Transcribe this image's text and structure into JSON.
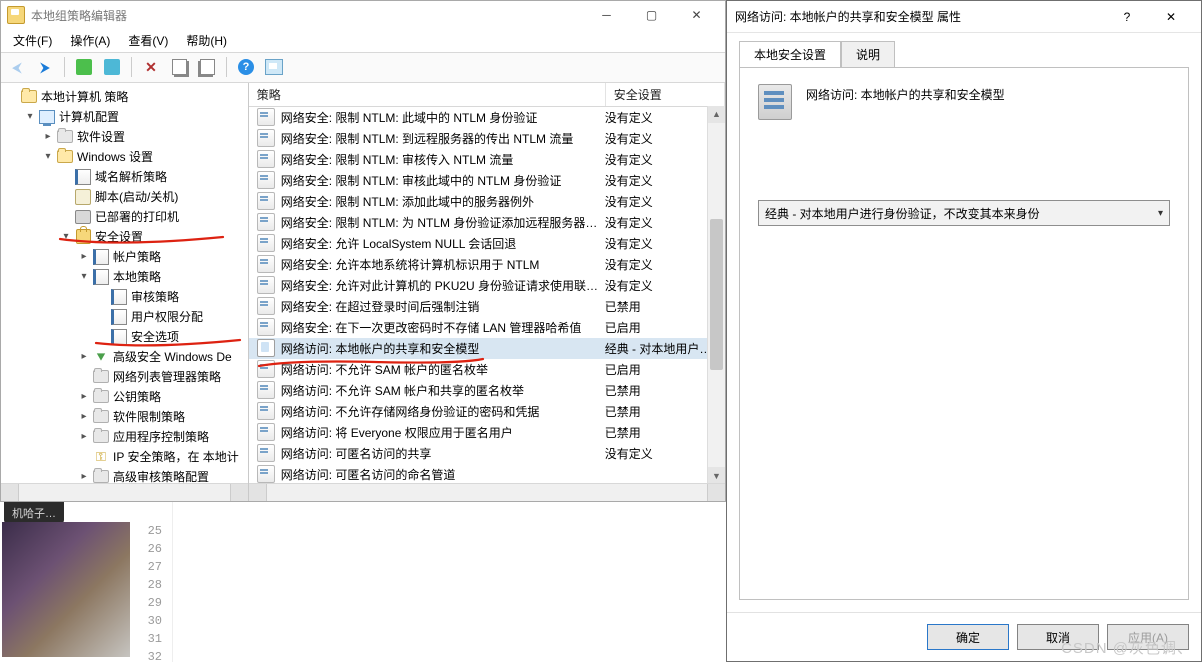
{
  "mmc": {
    "title": "本地组策略编辑器",
    "menu": {
      "file": "文件(F)",
      "action": "操作(A)",
      "view": "查看(V)",
      "help": "帮助(H)"
    },
    "columns": {
      "policy": "策略",
      "setting": "安全设置"
    }
  },
  "tree": {
    "root": "本地计算机 策略",
    "computerCfg": "计算机配置",
    "swSettings": "软件设置",
    "winSettings": "Windows 设置",
    "nameResPol": "域名解析策略",
    "scripts": "脚本(启动/关机)",
    "printers": "已部署的打印机",
    "secSettings": "安全设置",
    "acctPol": "帐户策略",
    "localPol": "本地策略",
    "auditPol": "审核策略",
    "userRights": "用户权限分配",
    "secOptions": "安全选项",
    "advFirewall": "高级安全 Windows De",
    "nlmPol": "网络列表管理器策略",
    "pubKeyPol": "公钥策略",
    "srPol": "软件限制策略",
    "appCtrl": "应用程序控制策略",
    "ipsec": "IP 安全策略，在 本地计",
    "advAudit": "高级审核策略配置"
  },
  "policies": [
    {
      "name": "网络安全: 限制 NTLM: 此域中的 NTLM 身份验证",
      "value": "没有定义",
      "icon": 1
    },
    {
      "name": "网络安全: 限制 NTLM: 到远程服务器的传出 NTLM 流量",
      "value": "没有定义",
      "icon": 1
    },
    {
      "name": "网络安全: 限制 NTLM: 审核传入 NTLM 流量",
      "value": "没有定义",
      "icon": 1
    },
    {
      "name": "网络安全: 限制 NTLM: 审核此域中的 NTLM 身份验证",
      "value": "没有定义",
      "icon": 1
    },
    {
      "name": "网络安全: 限制 NTLM: 添加此域中的服务器例外",
      "value": "没有定义",
      "icon": 1
    },
    {
      "name": "网络安全: 限制 NTLM: 为 NTLM 身份验证添加远程服务器…",
      "value": "没有定义",
      "icon": 1
    },
    {
      "name": "网络安全: 允许 LocalSystem NULL 会话回退",
      "value": "没有定义",
      "icon": 1
    },
    {
      "name": "网络安全: 允许本地系统将计算机标识用于 NTLM",
      "value": "没有定义",
      "icon": 1
    },
    {
      "name": "网络安全: 允许对此计算机的 PKU2U 身份验证请求使用联…",
      "value": "没有定义",
      "icon": 1
    },
    {
      "name": "网络安全: 在超过登录时间后强制注销",
      "value": "已禁用",
      "icon": 1
    },
    {
      "name": "网络安全: 在下一次更改密码时不存储 LAN 管理器哈希值",
      "value": "已启用",
      "icon": 1
    },
    {
      "name": "网络访问: 本地帐户的共享和安全模型",
      "value": "经典 - 对本地用户进行",
      "icon": 2,
      "sel": true
    },
    {
      "name": "网络访问: 不允许 SAM 帐户的匿名枚举",
      "value": "已启用",
      "icon": 1
    },
    {
      "name": "网络访问: 不允许 SAM 帐户和共享的匿名枚举",
      "value": "已禁用",
      "icon": 1
    },
    {
      "name": "网络访问: 不允许存储网络身份验证的密码和凭据",
      "value": "已禁用",
      "icon": 1
    },
    {
      "name": "网络访问: 将 Everyone 权限应用于匿名用户",
      "value": "已禁用",
      "icon": 1
    },
    {
      "name": "网络访问: 可匿名访问的共享",
      "value": "没有定义",
      "icon": 1
    },
    {
      "name": "网络访问: 可匿名访问的命名管道",
      "value": "",
      "icon": 1
    }
  ],
  "dialog": {
    "title": "网络访问: 本地帐户的共享和安全模型 属性",
    "tab_setting": "本地安全设置",
    "tab_explain": "说明",
    "policy_name": "网络访问: 本地帐户的共享和安全模型",
    "combo_value": "经典 - 对本地用户进行身份验证，不改变其本来身份",
    "help": "?",
    "ok": "确定",
    "cancel": "取消",
    "apply": "应用(A)"
  },
  "editor": {
    "tab": "机哈子…",
    "lines": [
      "25",
      "26",
      "27",
      "28",
      "29",
      "30",
      "31",
      "32"
    ]
  },
  "watermark": "CSDN @灰色调、"
}
